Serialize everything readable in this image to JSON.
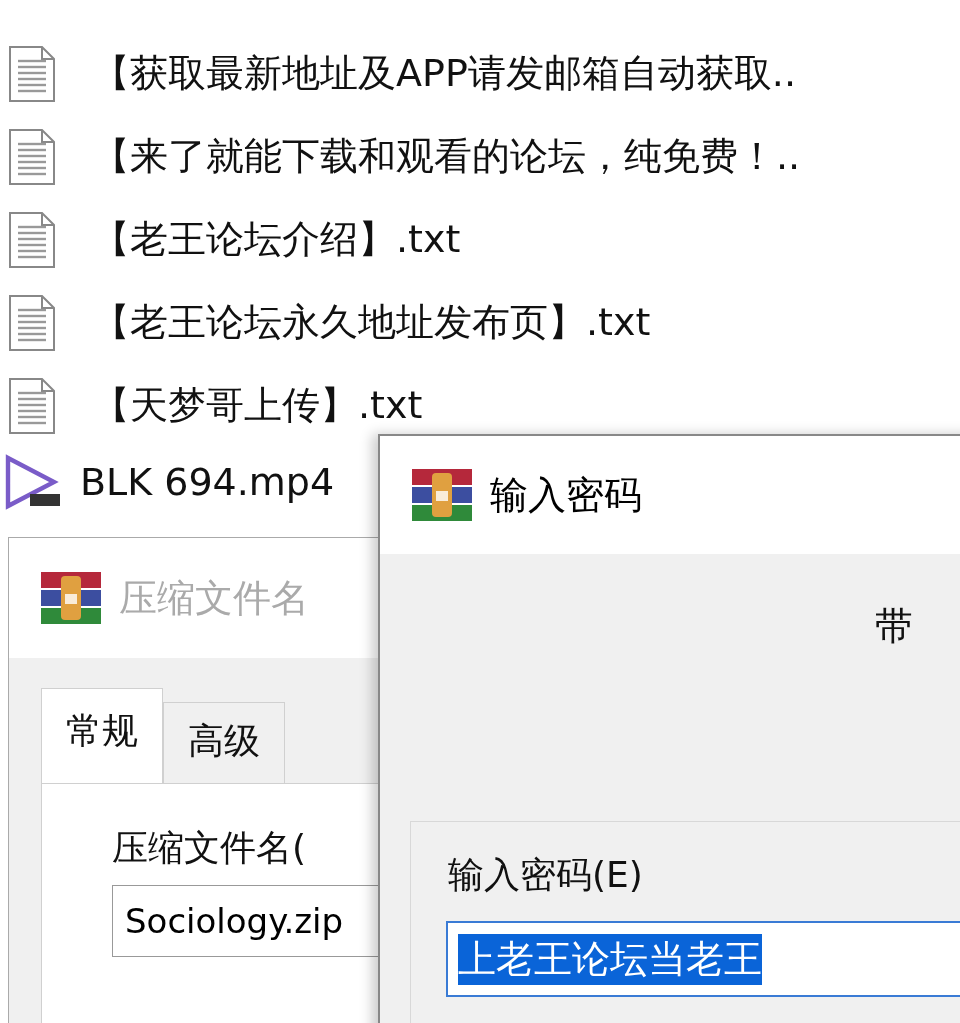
{
  "files": [
    {
      "name": "【获取最新地址及APP请发邮箱自动获取..",
      "kind": "text"
    },
    {
      "name": "【来了就能下载和观看的论坛，纯免费！..",
      "kind": "text"
    },
    {
      "name": "【老王论坛介绍】.txt",
      "kind": "text"
    },
    {
      "name": "【老王论坛永久地址发布页】.txt",
      "kind": "text"
    },
    {
      "name": "【天梦哥上传】.txt",
      "kind": "text"
    },
    {
      "name": "BLK 694.mp4",
      "kind": "video"
    }
  ],
  "archive_dialog": {
    "title": "压缩文件名",
    "active": false,
    "tabs": [
      {
        "label": "常规",
        "selected": true
      },
      {
        "label": "高级",
        "selected": false
      }
    ],
    "archive_name_label": "压缩文件名(",
    "archive_name": "Sociology.zip"
  },
  "password_dialog": {
    "title": "输入密码",
    "caption": "带",
    "group_label": "输入密码(E)",
    "password": "上老王论坛当老王",
    "password_selected": true
  }
}
